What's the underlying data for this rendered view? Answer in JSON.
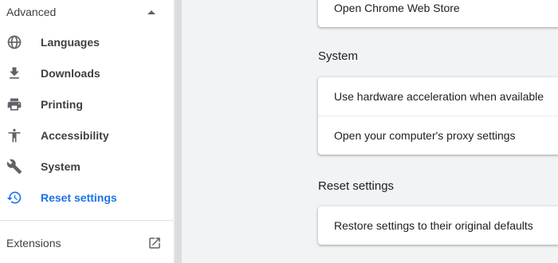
{
  "sidebar": {
    "advanced_label": "Advanced",
    "items": [
      {
        "label": "Languages",
        "icon": "globe-icon"
      },
      {
        "label": "Downloads",
        "icon": "download-icon"
      },
      {
        "label": "Printing",
        "icon": "printer-icon"
      },
      {
        "label": "Accessibility",
        "icon": "accessibility-icon"
      },
      {
        "label": "System",
        "icon": "wrench-icon"
      },
      {
        "label": "Reset settings",
        "icon": "restore-icon",
        "active": true
      }
    ],
    "extensions_label": "Extensions"
  },
  "main": {
    "top_card": {
      "row": "Open Chrome Web Store"
    },
    "system": {
      "title": "System",
      "rows": [
        "Use hardware acceleration when available",
        "Open your computer's proxy settings"
      ]
    },
    "reset": {
      "title": "Reset settings",
      "rows": [
        "Restore settings to their original defaults"
      ]
    }
  },
  "colors": {
    "accent": "#1a73e8",
    "background": "#f1f3f4",
    "text": "#3c4043",
    "icon": "#5f6368"
  }
}
